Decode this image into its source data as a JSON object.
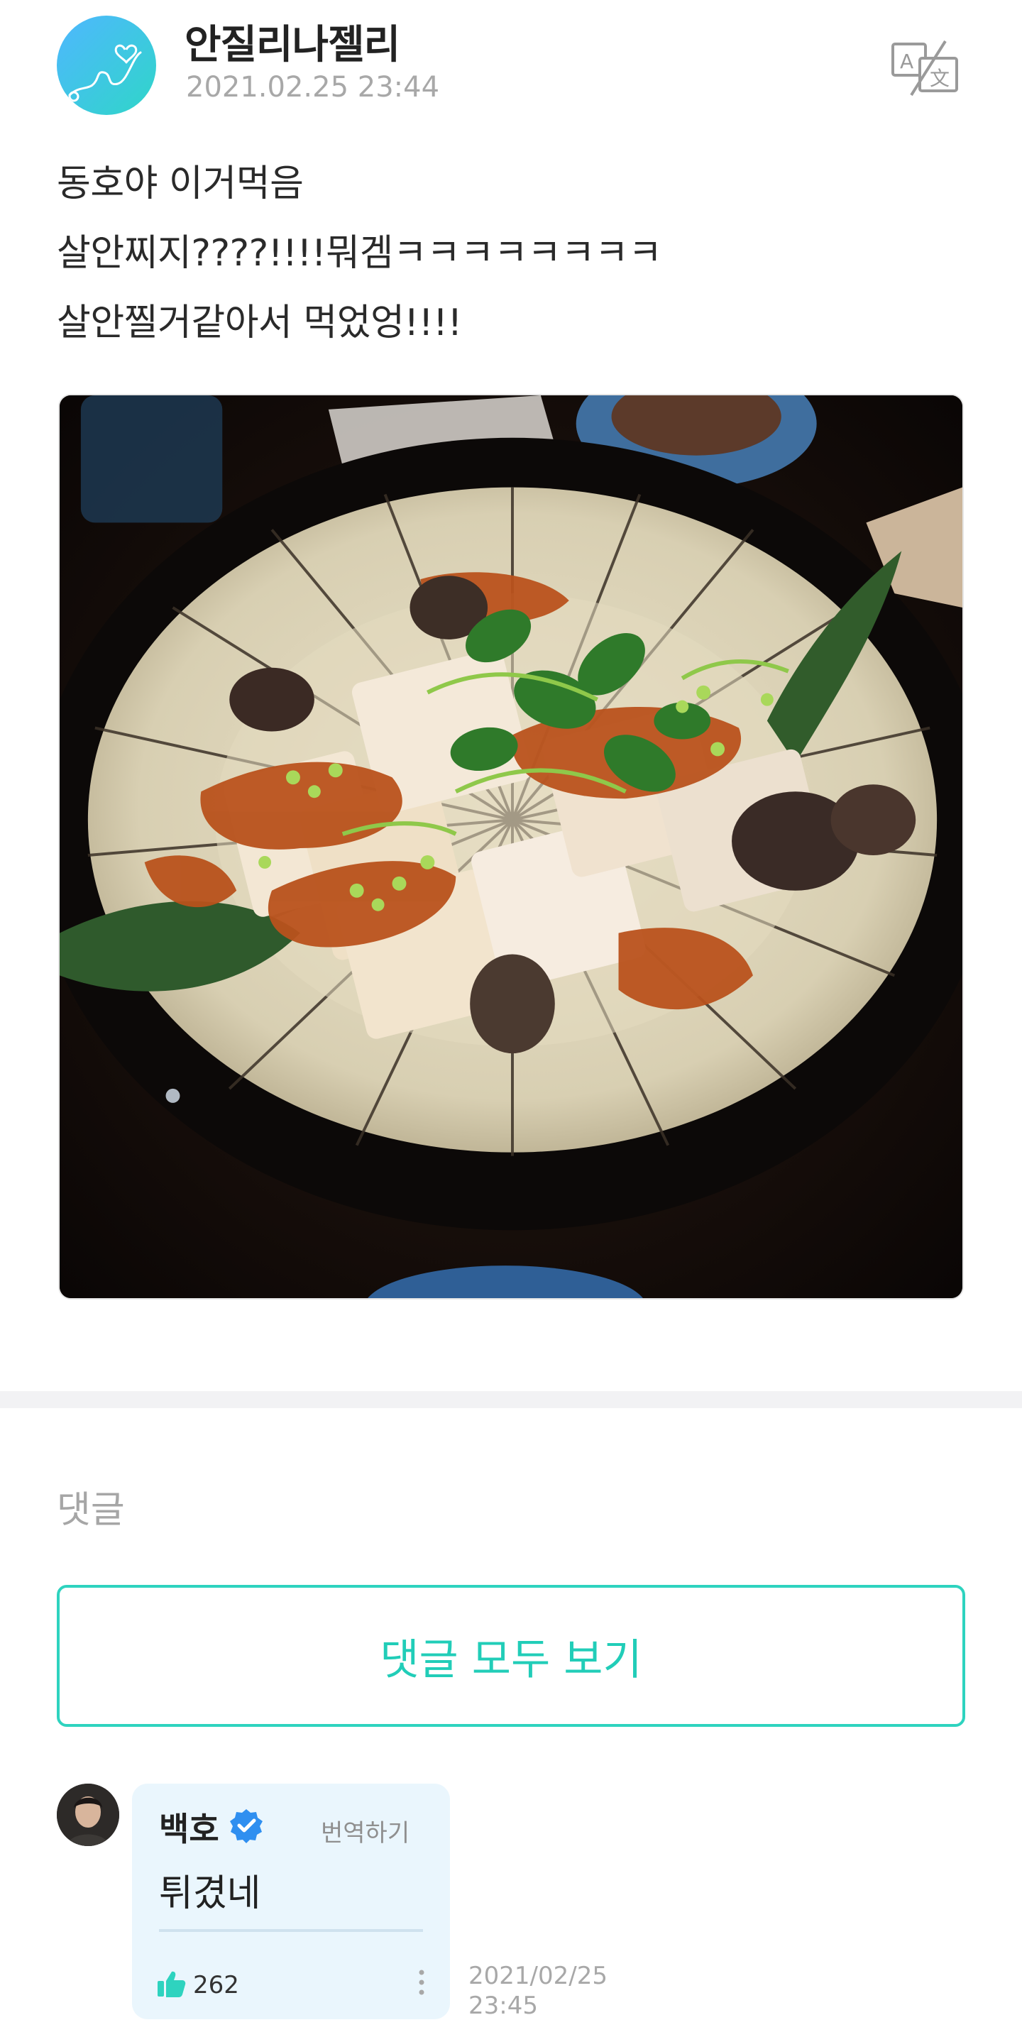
{
  "post": {
    "author": "안질리나젤리",
    "timestamp": "2021.02.25 23:44",
    "lines": [
      "동호야 이거먹음",
      "살안찌지????!!!!뭐겜ㅋㅋㅋㅋㅋㅋㅋㅋ",
      "살안찔거같아서 먹었엉!!!!"
    ],
    "avatar_icon": "heart-doodle-icon",
    "translate_icon": "translate-icon"
  },
  "comments": {
    "heading": "댓글",
    "view_all_label": "댓글 모두 보기",
    "items": [
      {
        "name": "백호",
        "verified_icon": "verified-check-icon",
        "translate_label": "번역하기",
        "text": "튀겼네",
        "likes": "262",
        "date": "2021/02/25",
        "time": "23:45"
      }
    ]
  },
  "colors": {
    "accent": "#21cdb8",
    "bubble": "#eaf6fd",
    "verified": "#2f8ff0",
    "like": "#2ed3bf",
    "muted": "#a8a8a8"
  }
}
